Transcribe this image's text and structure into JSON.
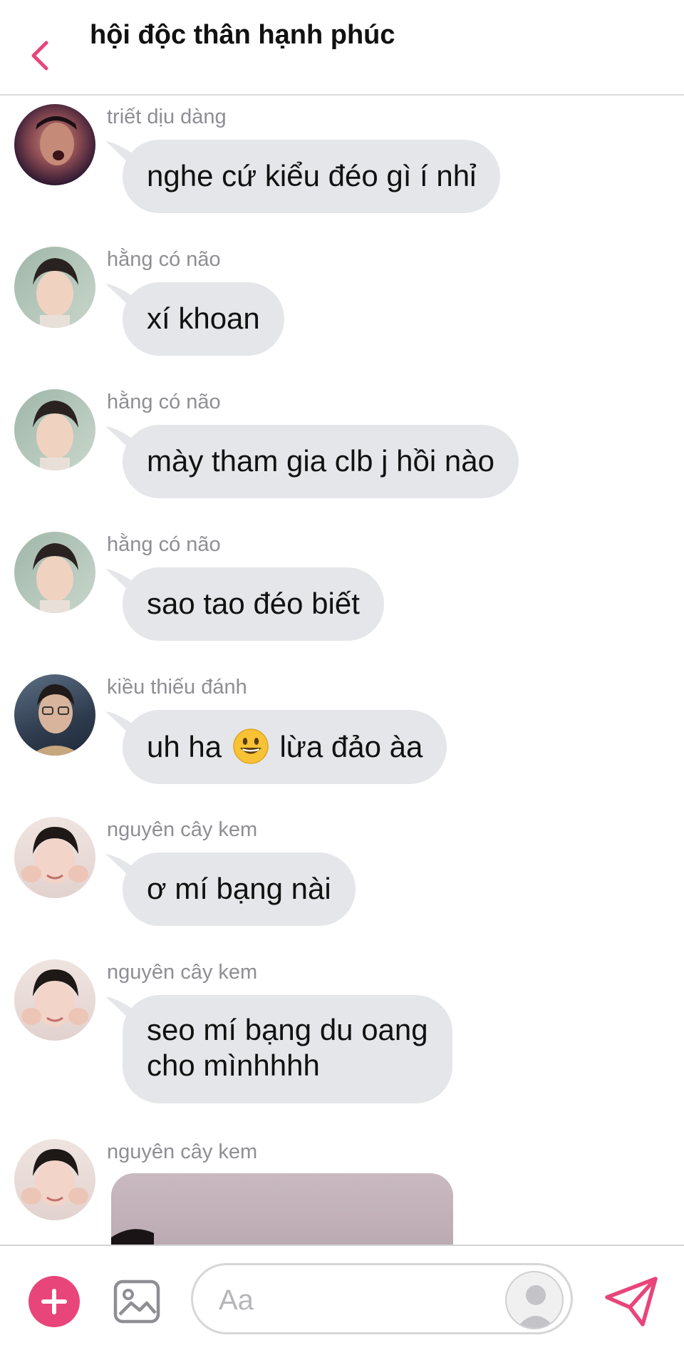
{
  "header": {
    "title": "hội độc thân hạnh phúc",
    "back_icon": "chevron-left-icon"
  },
  "colors": {
    "accent": "#e8457a",
    "bubble": "#e5e6ea",
    "sender_text": "#8e8e93"
  },
  "messages": [
    {
      "sender": "triết dịu dàng",
      "text": "nghe cứ kiểu đéo gì í nhỉ"
    },
    {
      "sender": "hằng có não",
      "text": "xí khoan"
    },
    {
      "sender": "hằng có não",
      "text": "mày tham gia clb j hồi nào"
    },
    {
      "sender": "hằng có não",
      "text": "sao tao đéo biết"
    },
    {
      "sender": "kiều thiếu đánh",
      "text_before": "uh ha",
      "emoji": "grinning-face",
      "text_after": "lừa đảo àa"
    },
    {
      "sender": "nguyên cây kem",
      "text": "ơ mí bạng nài"
    },
    {
      "sender": "nguyên cây kem",
      "line1": "seo mí bạng du oang",
      "line2": "cho mìnhhhh"
    },
    {
      "sender": "nguyên cây kem",
      "attachment": "photo"
    }
  ],
  "composer": {
    "placeholder": "Aa",
    "add_icon": "plus-icon",
    "image_icon": "image-icon",
    "send_icon": "paper-plane-icon"
  }
}
